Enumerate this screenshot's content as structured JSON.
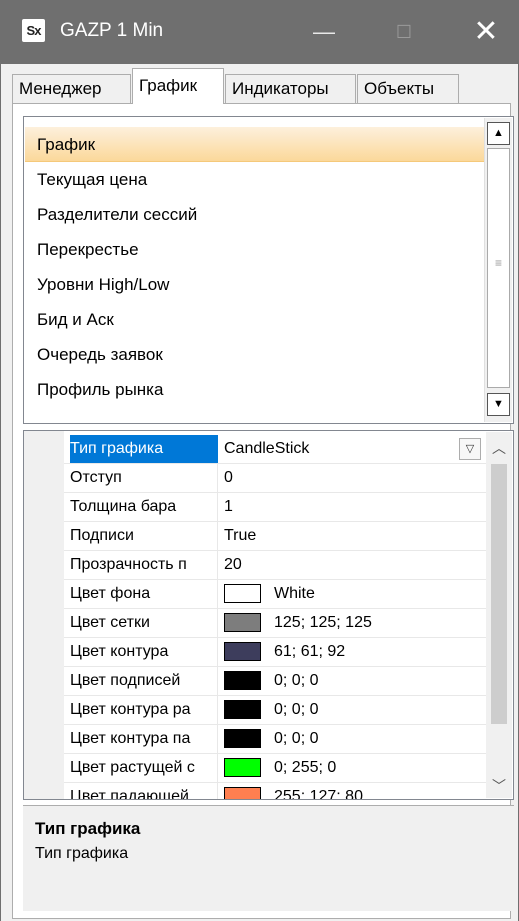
{
  "window": {
    "logo": "Sx",
    "title": "GAZP 1 Min",
    "minimize": "—",
    "maximize": "☐",
    "close": "✕"
  },
  "tabs": [
    {
      "label": "Менеджер",
      "active": false
    },
    {
      "label": "График",
      "active": true
    },
    {
      "label": "Индикаторы",
      "active": false
    },
    {
      "label": "Объекты",
      "active": false
    }
  ],
  "list": {
    "selected": "График",
    "items": [
      "График",
      "Текущая цена",
      "Разделители сессий",
      "Перекрестье",
      "Уровни High/Low",
      "Бид и Аск",
      "Очередь заявок",
      "Профиль рынка"
    ]
  },
  "properties": [
    {
      "name": "Тип графика",
      "value": "CandleStick",
      "selected": true,
      "dropdown": true
    },
    {
      "name": "Отступ",
      "value": "0"
    },
    {
      "name": "Толщина бара",
      "value": "1"
    },
    {
      "name": "Подписи",
      "value": "True"
    },
    {
      "name": "Прозрачность п",
      "value": "20"
    },
    {
      "name": "Цвет фона",
      "value": "White",
      "color": "#ffffff"
    },
    {
      "name": "Цвет сетки",
      "value": "125; 125; 125",
      "color": "#7d7d7d"
    },
    {
      "name": "Цвет контура",
      "value": "61; 61; 92",
      "color": "#3d3d5c"
    },
    {
      "name": "Цвет подписей",
      "value": "0; 0; 0",
      "color": "#000000"
    },
    {
      "name": "Цвет контура ра",
      "value": "0; 0; 0",
      "color": "#000000"
    },
    {
      "name": "Цвет контура па",
      "value": "0; 0; 0",
      "color": "#000000"
    },
    {
      "name": "Цвет растущей с",
      "value": "0; 255; 0",
      "color": "#00ff00"
    },
    {
      "name": "Цвет падающей",
      "value": "255; 127; 80",
      "color": "#ff7f50"
    }
  ],
  "description": {
    "title": "Тип графика",
    "text": "Тип графика"
  },
  "colors": {
    "titlebar": "#6f6f6f",
    "selection": "#0078d7",
    "list_selection": "#fbd89a"
  }
}
